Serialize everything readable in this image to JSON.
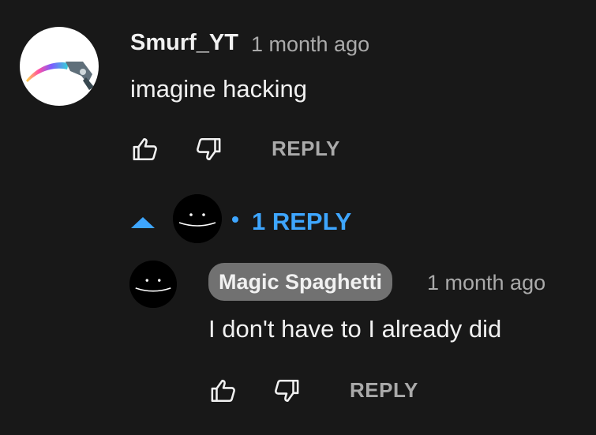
{
  "comment": {
    "author": "Smurf_YT",
    "timestamp": "1 month ago",
    "text": "imagine hacking",
    "avatar_icon": "karambit-knife-icon",
    "like_icon": "thumbs-up-icon",
    "dislike_icon": "thumbs-down-icon",
    "reply_label": "REPLY"
  },
  "replies_toggle": {
    "icon": "caret-up-icon",
    "avatar_icon": "smiley-face-icon",
    "count_label": "1 REPLY",
    "accent_color": "#3ea6ff"
  },
  "reply": {
    "author": "Magic Spaghetti",
    "timestamp": "1 month ago",
    "text": "I don't have to I already did",
    "avatar_icon": "smiley-face-icon",
    "like_icon": "thumbs-up-icon",
    "dislike_icon": "thumbs-down-icon",
    "reply_label": "REPLY"
  },
  "colors": {
    "background": "#181818",
    "text_primary": "#f1f1f1",
    "text_secondary": "#aaaaaa",
    "author_pill": "#717171",
    "accent": "#3ea6ff"
  }
}
